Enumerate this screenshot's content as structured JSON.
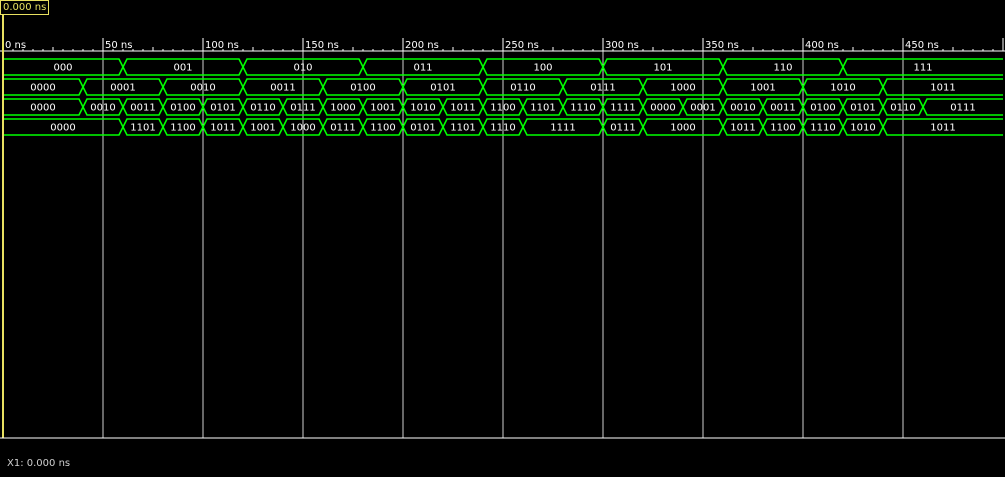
{
  "cursor": {
    "label": "0.000 ns"
  },
  "status": {
    "text": "X1: 0.000 ns"
  },
  "time_axis": {
    "unit": "ns",
    "ticks": [
      {
        "t": 0,
        "label": "0 ns"
      },
      {
        "t": 50,
        "label": "50 ns"
      },
      {
        "t": 100,
        "label": "100 ns"
      },
      {
        "t": 150,
        "label": "150 ns"
      },
      {
        "t": 200,
        "label": "200 ns"
      },
      {
        "t": 250,
        "label": "250 ns"
      },
      {
        "t": 300,
        "label": "300 ns"
      },
      {
        "t": 350,
        "label": "350 ns"
      },
      {
        "t": 400,
        "label": "400 ns"
      },
      {
        "t": 450,
        "label": "450 ns"
      }
    ]
  },
  "colors": {
    "bus": "#00ff00",
    "grid": "#ffffff",
    "cursor": "#e8e060",
    "text": "#ffffff",
    "background": "#000000"
  },
  "signals": [
    {
      "segments": [
        {
          "start": 0,
          "end": 60,
          "value": "000"
        },
        {
          "start": 60,
          "end": 120,
          "value": "001"
        },
        {
          "start": 120,
          "end": 180,
          "value": "010"
        },
        {
          "start": 180,
          "end": 240,
          "value": "011"
        },
        {
          "start": 240,
          "end": 300,
          "value": "100"
        },
        {
          "start": 300,
          "end": 360,
          "value": "101"
        },
        {
          "start": 360,
          "end": 420,
          "value": "110"
        },
        {
          "start": 420,
          "end": 500,
          "value": "111"
        }
      ]
    },
    {
      "segments": [
        {
          "start": 0,
          "end": 40,
          "value": "0000"
        },
        {
          "start": 40,
          "end": 80,
          "value": "0001"
        },
        {
          "start": 80,
          "end": 120,
          "value": "0010"
        },
        {
          "start": 120,
          "end": 160,
          "value": "0011"
        },
        {
          "start": 160,
          "end": 200,
          "value": "0100"
        },
        {
          "start": 200,
          "end": 240,
          "value": "0101"
        },
        {
          "start": 240,
          "end": 280,
          "value": "0110"
        },
        {
          "start": 280,
          "end": 320,
          "value": "0111"
        },
        {
          "start": 320,
          "end": 360,
          "value": "1000"
        },
        {
          "start": 360,
          "end": 400,
          "value": "1001"
        },
        {
          "start": 400,
          "end": 440,
          "value": "1010"
        },
        {
          "start": 440,
          "end": 500,
          "value": "1011"
        }
      ]
    },
    {
      "segments": [
        {
          "start": 0,
          "end": 40,
          "value": "0000"
        },
        {
          "start": 40,
          "end": 60,
          "value": "0010"
        },
        {
          "start": 60,
          "end": 80,
          "value": "0011"
        },
        {
          "start": 80,
          "end": 100,
          "value": "0100"
        },
        {
          "start": 100,
          "end": 120,
          "value": "0101"
        },
        {
          "start": 120,
          "end": 140,
          "value": "0110"
        },
        {
          "start": 140,
          "end": 160,
          "value": "0111"
        },
        {
          "start": 160,
          "end": 180,
          "value": "1000"
        },
        {
          "start": 180,
          "end": 200,
          "value": "1001"
        },
        {
          "start": 200,
          "end": 220,
          "value": "1010"
        },
        {
          "start": 220,
          "end": 240,
          "value": "1011"
        },
        {
          "start": 240,
          "end": 260,
          "value": "1100"
        },
        {
          "start": 260,
          "end": 280,
          "value": "1101"
        },
        {
          "start": 280,
          "end": 300,
          "value": "1110"
        },
        {
          "start": 300,
          "end": 320,
          "value": "1111"
        },
        {
          "start": 320,
          "end": 340,
          "value": "0000"
        },
        {
          "start": 340,
          "end": 360,
          "value": "0001"
        },
        {
          "start": 360,
          "end": 380,
          "value": "0010"
        },
        {
          "start": 380,
          "end": 400,
          "value": "0011"
        },
        {
          "start": 400,
          "end": 420,
          "value": "0100"
        },
        {
          "start": 420,
          "end": 440,
          "value": "0101"
        },
        {
          "start": 440,
          "end": 460,
          "value": "0110"
        },
        {
          "start": 460,
          "end": 500,
          "value": "0111"
        }
      ]
    },
    {
      "segments": [
        {
          "start": 0,
          "end": 60,
          "value": "0000"
        },
        {
          "start": 60,
          "end": 80,
          "value": "1101"
        },
        {
          "start": 80,
          "end": 100,
          "value": "1100"
        },
        {
          "start": 100,
          "end": 120,
          "value": "1011"
        },
        {
          "start": 120,
          "end": 140,
          "value": "1001"
        },
        {
          "start": 140,
          "end": 160,
          "value": "1000"
        },
        {
          "start": 160,
          "end": 180,
          "value": "0111"
        },
        {
          "start": 180,
          "end": 200,
          "value": "1100"
        },
        {
          "start": 200,
          "end": 220,
          "value": "0101"
        },
        {
          "start": 220,
          "end": 240,
          "value": "1101"
        },
        {
          "start": 240,
          "end": 260,
          "value": "1110"
        },
        {
          "start": 260,
          "end": 300,
          "value": "1111"
        },
        {
          "start": 300,
          "end": 320,
          "value": "0111"
        },
        {
          "start": 320,
          "end": 360,
          "value": "1000"
        },
        {
          "start": 360,
          "end": 380,
          "value": "1011"
        },
        {
          "start": 380,
          "end": 400,
          "value": "1100"
        },
        {
          "start": 400,
          "end": 420,
          "value": "1110"
        },
        {
          "start": 420,
          "end": 440,
          "value": "1010"
        },
        {
          "start": 440,
          "end": 500,
          "value": "1011"
        }
      ]
    }
  ]
}
